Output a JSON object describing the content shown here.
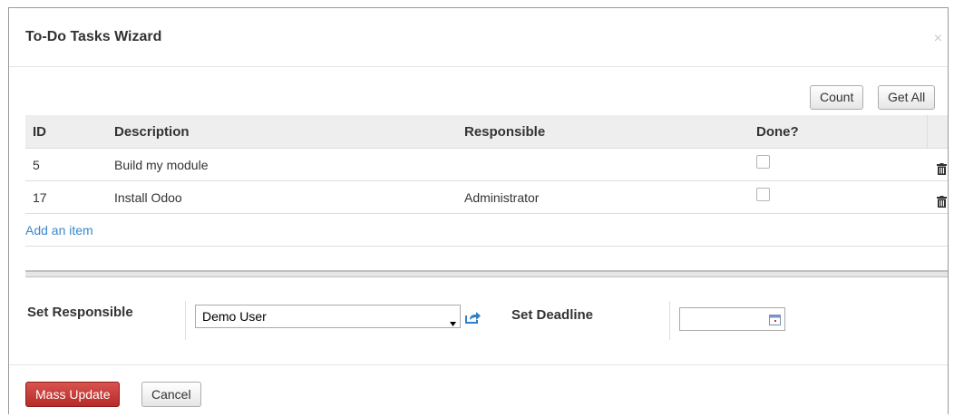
{
  "dialog": {
    "title": "To-Do Tasks Wizard",
    "close_icon": "×"
  },
  "toolbar": {
    "count_label": "Count",
    "get_all_label": "Get All"
  },
  "table": {
    "columns": [
      "ID",
      "Description",
      "Responsible",
      "Done?"
    ],
    "rows": [
      {
        "id": "5",
        "description": "Build my module",
        "responsible": "",
        "done": false
      },
      {
        "id": "17",
        "description": "Install Odoo",
        "responsible": "Administrator",
        "done": false
      }
    ],
    "add_item_label": "Add an item"
  },
  "form": {
    "set_responsible_label": "Set Responsible",
    "responsible_value": "Demo User",
    "set_deadline_label": "Set Deadline",
    "deadline_value": ""
  },
  "footer": {
    "mass_update_label": "Mass Update",
    "cancel_label": "Cancel"
  },
  "colors": {
    "primary_button": "#c9302c",
    "link": "#3a87c8",
    "table_header_bg": "#eeeeee"
  },
  "icons": {
    "close": "close-icon",
    "trash": "trash-icon",
    "external_link": "external-link-icon",
    "calendar": "calendar-icon",
    "dropdown": "chevron-down-icon"
  }
}
